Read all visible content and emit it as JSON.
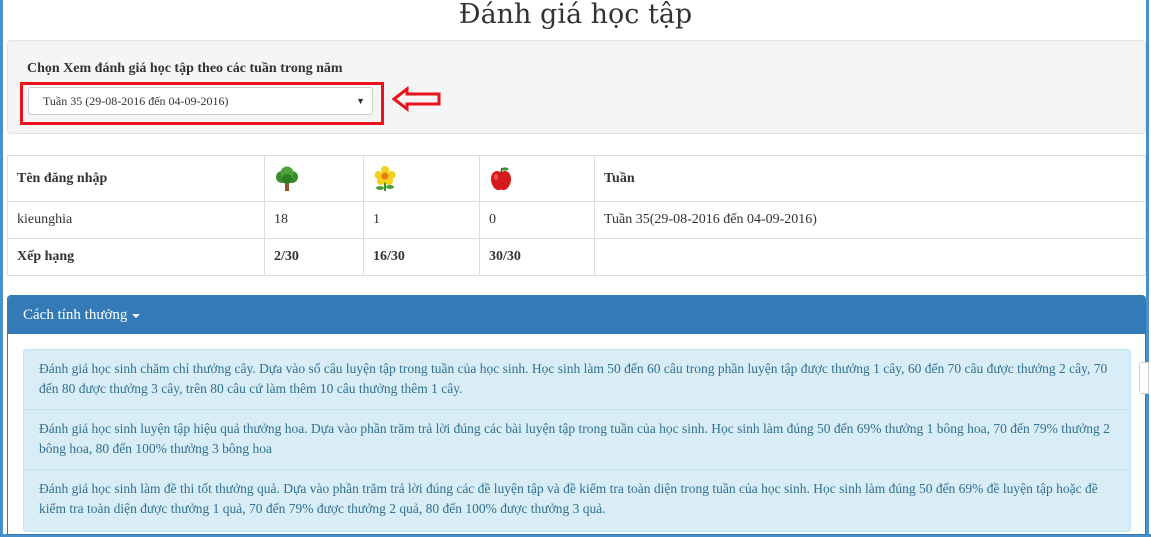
{
  "page": {
    "title": "Đánh giá học tập"
  },
  "filter": {
    "label": "Chọn Xem đánh giá học tập theo các tuần trong năm",
    "selected_week": "Tuần 35 (29-08-2016 đến 04-09-2016)"
  },
  "stats_table": {
    "headers": {
      "username": "Tên đăng nhập",
      "tree_icon": "tree-icon",
      "flower_icon": "flower-icon",
      "apple_icon": "apple-icon",
      "week": "Tuần"
    },
    "user_row": {
      "username": "kieunghia",
      "trees": "18",
      "flowers": "1",
      "fruits": "0",
      "week": "Tuần 35(29-08-2016 đến 04-09-2016)"
    },
    "rank_row": {
      "label": "Xếp hạng",
      "trees": "2/30",
      "flowers": "16/30",
      "fruits": "30/30"
    }
  },
  "reward_panel": {
    "title": "Cách tính thưởng",
    "items": [
      "Đánh giá học sinh chăm chỉ thưởng cây. Dựa vào số câu luyện tập trong tuần của học sinh. Học sinh làm 50 đến 60 câu trong phần luyện tập được thưởng 1 cây, 60 đến 70 câu được thưởng 2 cây, 70 đến 80 được thưởng 3 cây, trên 80 câu cứ làm thêm 10 câu thưởng thêm 1 cây.",
      "Đánh giá học sinh luyện tập hiệu quả thưởng hoa. Dựa vào phần trăm trả lời đúng các bài luyện tập trong tuần của học sinh. Học sinh làm đúng 50 đến 69% thưởng 1 bông hoa, 70 đến 79% thưởng 2 bông hoa, 80 đến 100% thưởng 3 bông hoa",
      "Đánh giá học sinh làm đề thi tốt thưởng quả. Dựa vào phần trăm trả lời đúng các đề luyện tập và đề kiểm tra toàn diện trong tuần của học sinh. Học sinh làm đúng 50 đến 69% đề luyện tập hoặc đề kiểm tra toàn diện được thưởng 1 quả, 70 đến 79% được thưởng 2 quả, 80 đến 100% được thưởng 3 quả."
    ]
  },
  "colors": {
    "panel_primary": "#337ab7",
    "info_background": "#d9edf7",
    "info_text": "#31708f",
    "highlight_annotation": "#e8131b"
  }
}
